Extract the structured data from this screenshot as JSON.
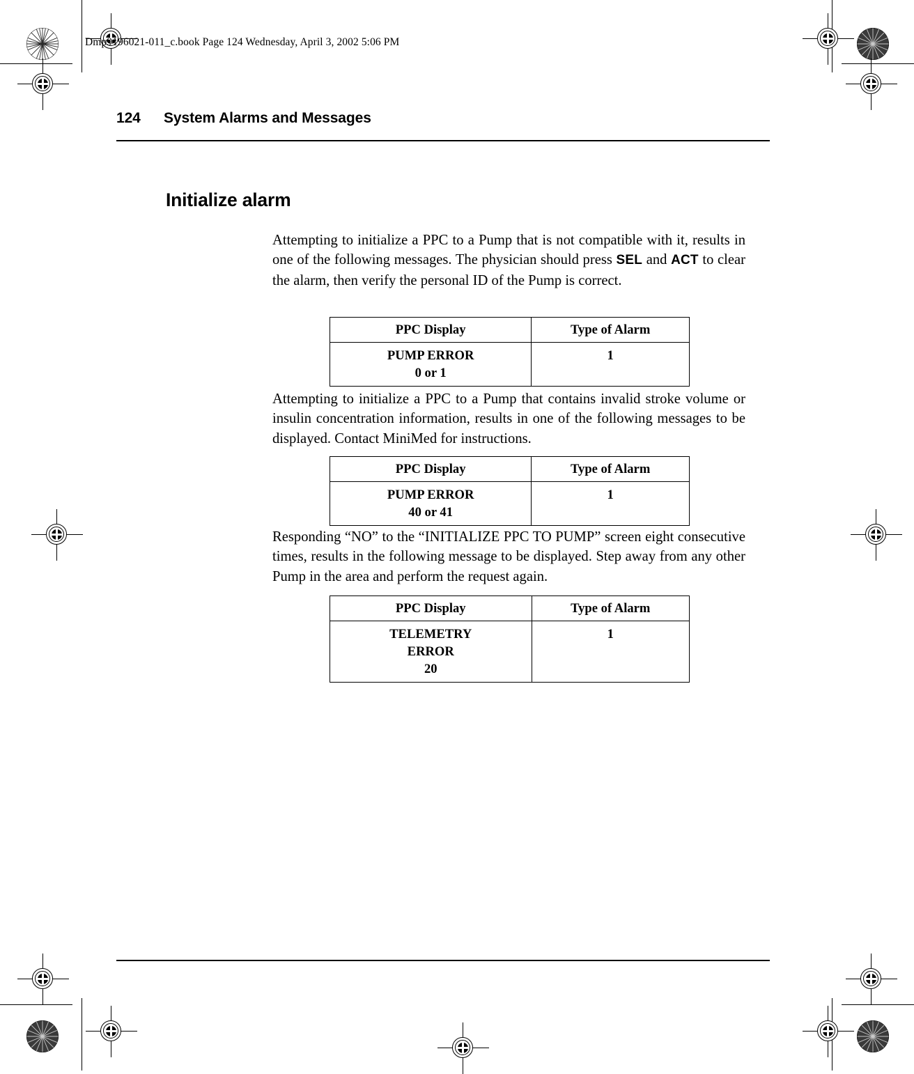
{
  "print_marks": {
    "file_stamp": "Dmp9196021-011_c.book  Page 124  Wednesday, April 3, 2002  5:06 PM",
    "registration_icon": "registration-target-icon",
    "rosette_icon": "color-rosette-icon"
  },
  "page_header": {
    "page_number": "124",
    "title": "System Alarms and Messages"
  },
  "section": {
    "heading": "Initialize alarm"
  },
  "paragraphs": {
    "p1_a": "Attempting to initialize a PPC to a Pump that is not compatible with it, results in one of the following messages. The physician should press ",
    "p1_key1": "SEL",
    "p1_b": " and ",
    "p1_key2": "ACT",
    "p1_c": " to clear the alarm, then verify the personal ID of the Pump is correct.",
    "p2": "Attempting to initialize a PPC to a Pump that contains invalid stroke volume or insulin concentration information, results in one of the following messages to be displayed.  Contact MiniMed for instructions.",
    "p3": "Responding “NO” to the “INITIALIZE PPC TO PUMP” screen eight consecutive times, results in the following message to be displayed. Step away from any other Pump in the area and perform the request again."
  },
  "tables": {
    "headers": {
      "col1": "PPC Display",
      "col2": "Type of Alarm"
    },
    "table1": {
      "display_line1": "PUMP ERROR",
      "display_line2": "0 or 1",
      "alarm_type": "1"
    },
    "table2": {
      "display_line1": "PUMP ERROR",
      "display_line2": "40 or 41",
      "alarm_type": "1"
    },
    "table3": {
      "display_line1": "TELEMETRY",
      "display_line2": "ERROR",
      "display_line3": "20",
      "alarm_type": "1"
    }
  }
}
